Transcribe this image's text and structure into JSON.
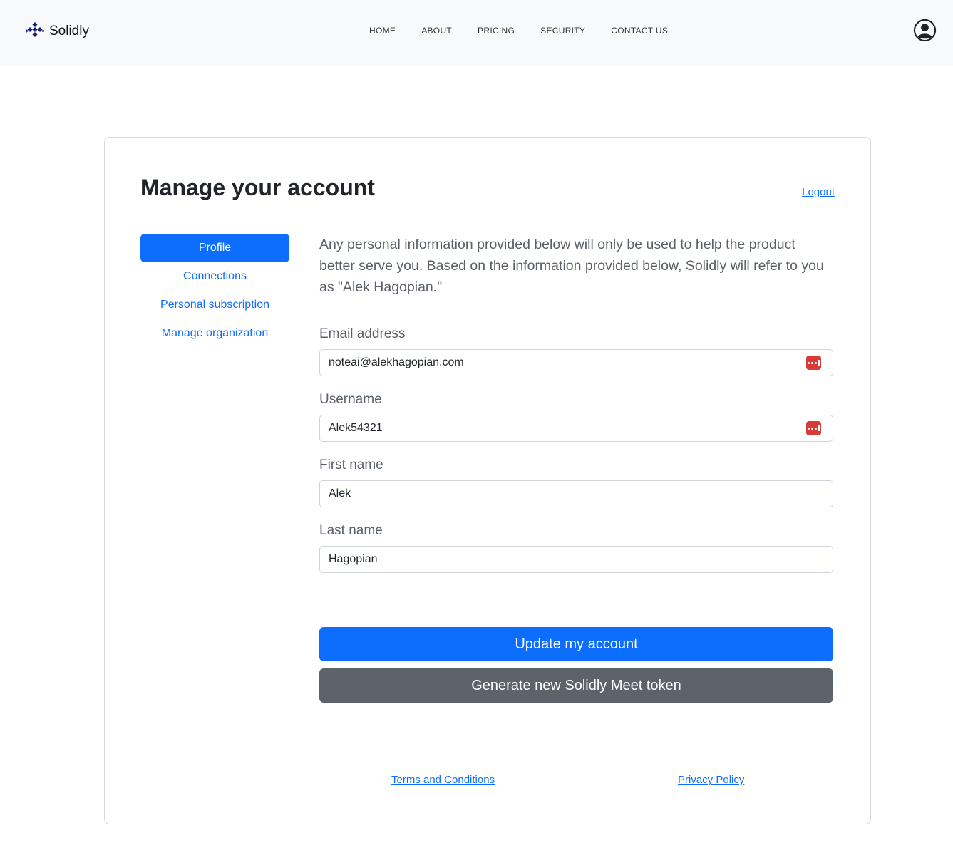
{
  "header": {
    "brand": "Solidly",
    "nav": [
      "HOME",
      "ABOUT",
      "PRICING",
      "SECURITY",
      "CONTACT US"
    ]
  },
  "account": {
    "title": "Manage your account",
    "logout": "Logout",
    "sidebar": [
      "Profile",
      "Connections",
      "Personal subscription",
      "Manage organization"
    ],
    "intro": "Any personal information provided below will only be used to help the product better serve you. Based on the information provided below, Solidly will refer to you as \"Alek Hagopian.\"",
    "fields": {
      "email": {
        "label": "Email address",
        "value": "noteai@alekhagopian.com"
      },
      "username": {
        "label": "Username",
        "value": "Alek54321"
      },
      "first_name": {
        "label": "First name",
        "value": "Alek"
      },
      "last_name": {
        "label": "Last name",
        "value": "Hagopian"
      }
    },
    "update_button": "Update my account",
    "token_button": "Generate new Solidly Meet token"
  },
  "footer": {
    "terms": "Terms and Conditions",
    "privacy": "Privacy Policy"
  },
  "colors": {
    "primary": "#0d6efd",
    "secondary": "#5c636a",
    "navbar_bg": "#f8f9fa",
    "password_manager_icon": "#d93a35",
    "brand_icon": "#1b1f7a"
  },
  "icons": [
    "solidly-logo-icon",
    "user-circle-icon",
    "password-manager-icon"
  ]
}
